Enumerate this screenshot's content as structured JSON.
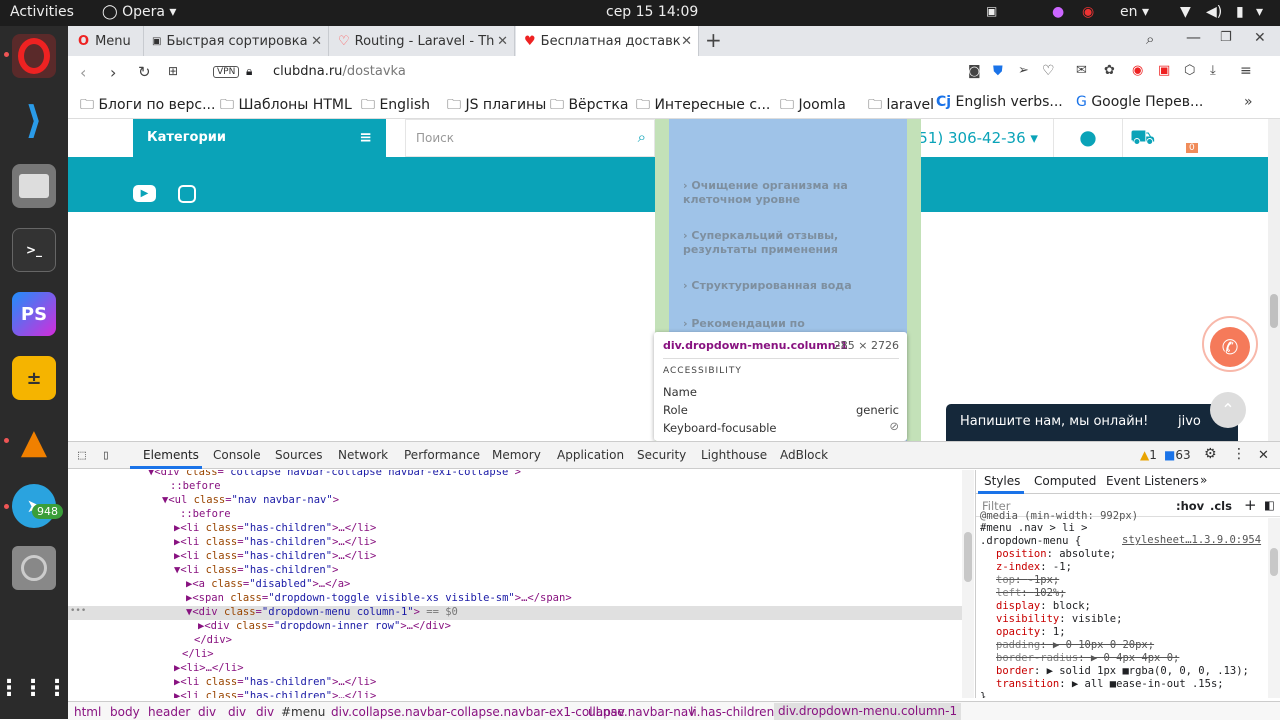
{
  "topbar": {
    "activities": "Activities",
    "app": "Opera",
    "datetime": "сер 15  14:09",
    "lang": "en"
  },
  "dock": {
    "telegram_badge": "948"
  },
  "tabs": [
    {
      "label": "Menu"
    },
    {
      "label": "Быстрая сортировка"
    },
    {
      "label": "Routing - Laravel - Th"
    },
    {
      "label": "Бесплатная доставк"
    }
  ],
  "address": {
    "vpn": "VPN",
    "host": "clubdna.ru",
    "path": "/dostavka"
  },
  "bookmarks": [
    "Блоги по верс...",
    "Шаблоны HTML",
    "English",
    "JS плагины",
    "Вёрстка",
    "Интересные с...",
    "Joomla",
    "laravel",
    "English verbs...",
    "Google Перев..."
  ],
  "site": {
    "categories": "Категории",
    "search_placeholder": "Поиск",
    "phone": "+7 (951) 306-42-36",
    "cart_count": "0",
    "menu_items": [
      "Очищение организма на клеточном уровне",
      "Суперкальций отзывы, результаты применения",
      "Структурированная вода",
      "Рекомендации по"
    ],
    "chat": "Напишите нам, мы онлайн!",
    "jivo": "jivo"
  },
  "tooltip": {
    "selector": "div.dropdown-menu.column-1",
    "size": "285 × 2726",
    "section": "ACCESSIBILITY",
    "rows": [
      {
        "k": "Name",
        "v": ""
      },
      {
        "k": "Role",
        "v": "generic"
      },
      {
        "k": "Keyboard-focusable",
        "v": ""
      }
    ]
  },
  "devtools": {
    "tabs": [
      "Elements",
      "Console",
      "Sources",
      "Network",
      "Performance",
      "Memory",
      "Application",
      "Security",
      "Lighthouse",
      "AdBlock"
    ],
    "warnings": "1",
    "messages": "63",
    "side_tabs": [
      "Styles",
      "Computed",
      "Event Listeners"
    ],
    "filter_placeholder": "Filter",
    "hov": ":hov",
    ".cls": ".cls",
    "dom": [
      {
        "t": "▼<div class=\"collapse navbar-collapse navbar-ex1-collapse\">"
      },
      {
        "t": "::before"
      },
      {
        "t": "▼<ul class=\"nav navbar-nav\">"
      },
      {
        "t": "::before"
      },
      {
        "t": "▶<li class=\"has-children\">…</li>"
      },
      {
        "t": "▶<li class=\"has-children\">…</li>"
      },
      {
        "t": "▶<li class=\"has-children\">…</li>"
      },
      {
        "t": "▼<li class=\"has-children\">"
      },
      {
        "t": "▶<a class=\"disabled\">…</a>"
      },
      {
        "t": "▶<span class=\"dropdown-toggle visible-xs visible-sm\">…</span>"
      },
      {
        "t": "▼<div class=\"dropdown-menu column-1\"> == $0"
      },
      {
        "t": "▶<div class=\"dropdown-inner row\">…</div>"
      },
      {
        "t": "</div>"
      },
      {
        "t": "</li>"
      },
      {
        "t": "▶<li>…</li>"
      },
      {
        "t": "▶<li class=\"has-children\">…</li>"
      },
      {
        "t": "▶<li class=\"has-children\">…</li>"
      }
    ],
    "css": [
      {
        "t": "@media (min-width: 992px)"
      },
      {
        "t": "#menu .nav > li >"
      },
      {
        "t": "stylesheet…1.3.9.0:954"
      },
      {
        "t": ".dropdown-menu {"
      },
      {
        "p": "position",
        "v": "absolute;"
      },
      {
        "p": "z-index",
        "v": "-1;"
      },
      {
        "p": "top",
        "v": "-1px;",
        "s": true
      },
      {
        "p": "left",
        "v": "102%;",
        "s": true
      },
      {
        "p": "display",
        "v": "block;"
      },
      {
        "p": "visibility",
        "v": "visible;"
      },
      {
        "p": "opacity",
        "v": "1;"
      },
      {
        "p": "padding",
        "v": "▶ 0 10px 0 20px;",
        "s": true
      },
      {
        "p": "border-radius",
        "v": "▶ 0 4px 4px 0;",
        "s": true
      },
      {
        "p": "border",
        "v": "▶ solid 1px ■rgba(0, 0, 0, .13);"
      },
      {
        "p": "transition",
        "v": "▶ all ■ease-in-out .15s;"
      },
      {
        "t": "}"
      }
    ],
    "breadcrumbs": [
      "html",
      "body",
      "header",
      "div",
      "div",
      "div",
      "#menu",
      "div.collapse.navbar-collapse.navbar-ex1-collapse",
      "ul.nav.navbar-nav",
      "li.has-children",
      "div.dropdown-menu.column-1"
    ]
  }
}
